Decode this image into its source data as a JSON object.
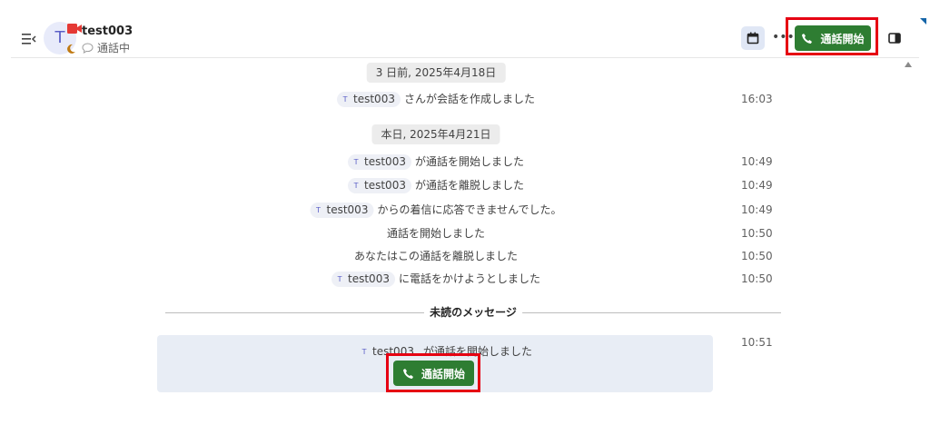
{
  "header": {
    "avatar_initial": "T",
    "contact_name": "test003",
    "status_text": "通話中",
    "call_button_label": "通話開始"
  },
  "timeline": {
    "date_groups": [
      {
        "date_label": "3 日前, 2025年4月18日",
        "events": [
          {
            "user": "test003",
            "text": "さんが会話を作成しました",
            "time": "16:03"
          }
        ]
      },
      {
        "date_label": "本日, 2025年4月21日",
        "events": [
          {
            "user": "test003",
            "text": "が通話を開始しました",
            "time": "10:49"
          },
          {
            "user": "test003",
            "text": "が通話を離脱しました",
            "time": "10:49"
          },
          {
            "user": "test003",
            "text": "からの着信に応答できませんでした。",
            "time": "10:49"
          },
          {
            "user": "",
            "text": "通話を開始しました",
            "time": "10:50"
          },
          {
            "user": "",
            "text": "あなたはこの通話を離脱しました",
            "time": "10:50"
          },
          {
            "user": "test003",
            "text": "に電話をかけようとしました",
            "time": "10:50"
          }
        ]
      }
    ],
    "unread_divider_label": "未読のメッセージ",
    "unread_event": {
      "user": "test003",
      "text": "が通話を開始しました",
      "time": "10:51",
      "join_button_label": "通話開始"
    },
    "mention_avatar_initial": "T"
  },
  "colors": {
    "call_button": "#2e7d32",
    "highlight": "#e60012",
    "avatar_bg": "#e8ebfa",
    "unread_card_bg": "#e8edf5"
  }
}
